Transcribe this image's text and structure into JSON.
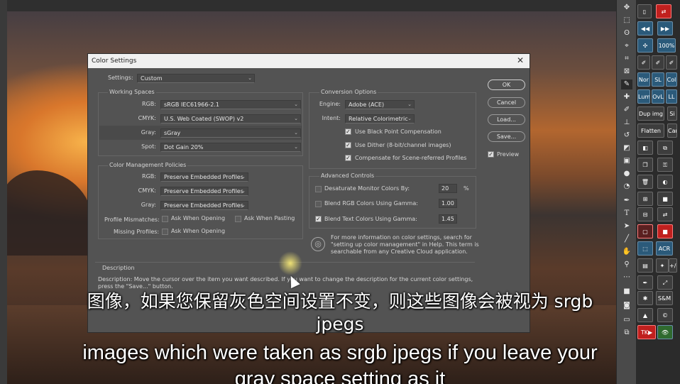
{
  "dialog": {
    "title": "Color Settings",
    "settings_label": "Settings:",
    "settings_value": "Custom",
    "working_spaces": {
      "heading": "Working Spaces",
      "rgb_label": "RGB:",
      "rgb_value": "sRGB IEC61966-2.1",
      "cmyk_label": "CMYK:",
      "cmyk_value": "U.S. Web Coated (SWOP) v2",
      "gray_label": "Gray:",
      "gray_value": "sGray",
      "spot_label": "Spot:",
      "spot_value": "Dot Gain 20%"
    },
    "policies": {
      "heading": "Color Management Policies",
      "rgb_label": "RGB:",
      "rgb_value": "Preserve Embedded Profiles",
      "cmyk_label": "CMYK:",
      "cmyk_value": "Preserve Embedded Profiles",
      "gray_label": "Gray:",
      "gray_value": "Preserve Embedded Profiles",
      "mismatch_label": "Profile Mismatches:",
      "ask_opening": "Ask When Opening",
      "ask_pasting": "Ask When Pasting",
      "missing_label": "Missing Profiles:",
      "missing_ask_opening": "Ask When Opening"
    },
    "conversion": {
      "heading": "Conversion Options",
      "engine_label": "Engine:",
      "engine_value": "Adobe (ACE)",
      "intent_label": "Intent:",
      "intent_value": "Relative Colorimetric",
      "bpc": "Use Black Point Compensation",
      "dither": "Use Dither (8-bit/channel images)",
      "compensate": "Compensate for Scene-referred Profiles"
    },
    "advanced": {
      "heading": "Advanced Controls",
      "desaturate": "Desaturate Monitor Colors By:",
      "desaturate_value": "20",
      "desaturate_unit": "%",
      "blend_rgb": "Blend RGB Colors Using Gamma:",
      "blend_rgb_value": "1.00",
      "blend_text": "Blend Text Colors Using Gamma:",
      "blend_text_value": "1.45"
    },
    "info_text_1": "For more information on color settings, search for",
    "info_text_2": "\"setting up color management\" in Help. This term is",
    "info_text_3": "searchable from any Creative Cloud application.",
    "description_heading": "Description",
    "description_text_1": "Description: Move the cursor over the item you want described. If you want to change the description for the current color settings,",
    "description_text_2": "press the \"Save...\" button.",
    "buttons": {
      "ok": "OK",
      "cancel": "Cancel",
      "load": "Load...",
      "save": "Save...",
      "preview": "Preview"
    }
  },
  "panel": {
    "b100": "100%",
    "nor": "Nor",
    "sl": "SL",
    "col": "Col",
    "lum": "Lum",
    "ovl": "OvL",
    "ll": "LL",
    "dup": "Dup img",
    "si": "Si",
    "flatten": "Flatten",
    "can": "Can",
    "acr": "ACR",
    "pm": "+/-",
    "sm": "S&M",
    "tk": "TK▶"
  },
  "subtitles": {
    "cn_line1": "图像，如果您保留灰色空间设置不变，则这些图像会被视为 srgb",
    "cn_line2": "jpegs",
    "en_line1": "images which were taken as srgb jpegs if you leave your",
    "en_line2": "gray space setting as it"
  }
}
